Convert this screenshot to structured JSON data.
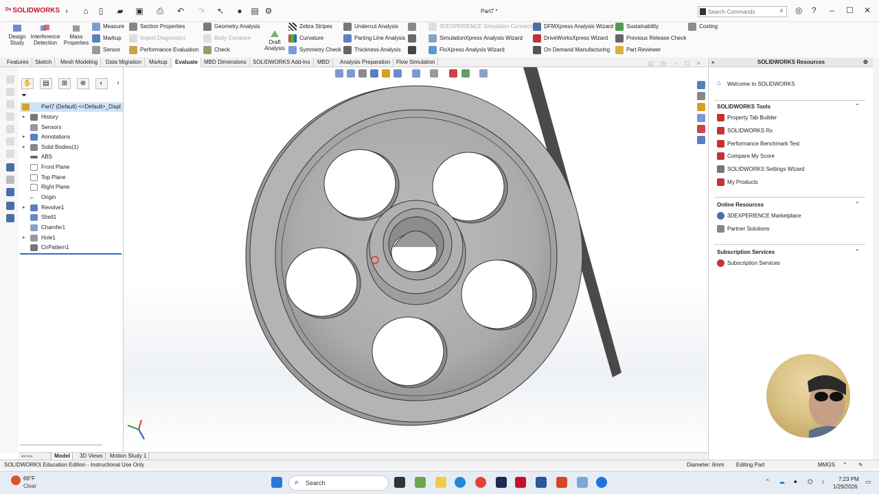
{
  "app": {
    "logo": "SOLIDWORKS",
    "doc_title": "Part7 *",
    "search_placeholder": "Search Commands"
  },
  "ribbon": {
    "big_tools": [
      {
        "label": "Design Study"
      },
      {
        "label": "Interference Detection"
      },
      {
        "label": "Mass Properties"
      },
      {
        "label": "Draft Analysis"
      }
    ],
    "col1": [
      "Measure",
      "Markup",
      "Sensor"
    ],
    "col2": [
      "Section Properties",
      "Import Diagnostics",
      "Performance Evaluation"
    ],
    "col3": [
      "Geometry Analysis",
      "Body Compare",
      "Check"
    ],
    "col4": [
      "Zebra Stripes",
      "Curvature",
      "Symmetry Check"
    ],
    "col5": [
      "Undercut Analysis",
      "Parting Line Analysis",
      "Thickness Analysis"
    ],
    "col6": [
      "3DEXPERIENCE Simulation Connector",
      "SimulationXpress Analysis Wizard",
      "FloXpress Analysis Wizard"
    ],
    "col7": [
      "DFMXpress Analysis Wizard",
      "DriveWorksXpress Wizard",
      "On Demand Manufacturing"
    ],
    "col8": [
      "Sustainability",
      "Previous Release Check",
      "Part Reviewer"
    ],
    "col9": [
      "Costing"
    ]
  },
  "command_tabs": [
    "Features",
    "Sketch",
    "Mesh Modeling",
    "Data Migration",
    "Markup",
    "Evaluate",
    "MBD Dimensions",
    "SOLIDWORKS Add-Ins",
    "MBD",
    "Analysis Preparation",
    "Flow Simulation"
  ],
  "active_tab": "Evaluate",
  "feature_tree": {
    "root": "Part7 (Default) <<Default>_Displ",
    "items": [
      {
        "label": "History",
        "expand": "▸"
      },
      {
        "label": "Sensors",
        "expand": ""
      },
      {
        "label": "Annotations",
        "expand": "▸"
      },
      {
        "label": "Solid Bodies(1)",
        "expand": "▸"
      },
      {
        "label": "ABS",
        "expand": ""
      },
      {
        "label": "Front Plane",
        "expand": ""
      },
      {
        "label": "Top Plane",
        "expand": ""
      },
      {
        "label": "Right Plane",
        "expand": ""
      },
      {
        "label": "Origin",
        "expand": ""
      },
      {
        "label": "Revolve1",
        "expand": "▸"
      },
      {
        "label": "Shell1",
        "expand": ""
      },
      {
        "label": "Chamfer1",
        "expand": ""
      },
      {
        "label": "Hole1",
        "expand": "▸"
      },
      {
        "label": "CirPattern1",
        "expand": ""
      }
    ]
  },
  "bottom_tabs": [
    "Model",
    "3D Views",
    "Motion Study 1"
  ],
  "task_pane": {
    "title": "SOLIDWORKS Resources",
    "welcome": "Welcome to SOLIDWORKS",
    "sections": [
      {
        "title": "SOLIDWORKS Tools",
        "items": [
          "Property Tab Builder",
          "SOLIDWORKS Rx",
          "Performance Benchmark Test",
          "Compare My Score",
          "SOLIDWORKS Settings Wizard",
          "My Products"
        ]
      },
      {
        "title": "Online Resources",
        "items": [
          "3DEXPERIENCE Marketplace",
          "Partner Solutions"
        ]
      },
      {
        "title": "Subscription Services",
        "items": [
          "Subscription Services"
        ]
      }
    ]
  },
  "status": {
    "edition": "SOLIDWORKS Education Edition - Instructional Use Only",
    "measure": "Diameter: 6mm",
    "mode": "Editing Part",
    "units": "MMGS"
  },
  "taskbar": {
    "temp": "66°F",
    "condition": "Clear",
    "search": "Search",
    "time": "7:23 PM",
    "date": "1/29/2026"
  },
  "colors": {
    "brand": "#c8102e",
    "accent": "#2a6fc9",
    "part_gray": "#a9a9a9"
  }
}
